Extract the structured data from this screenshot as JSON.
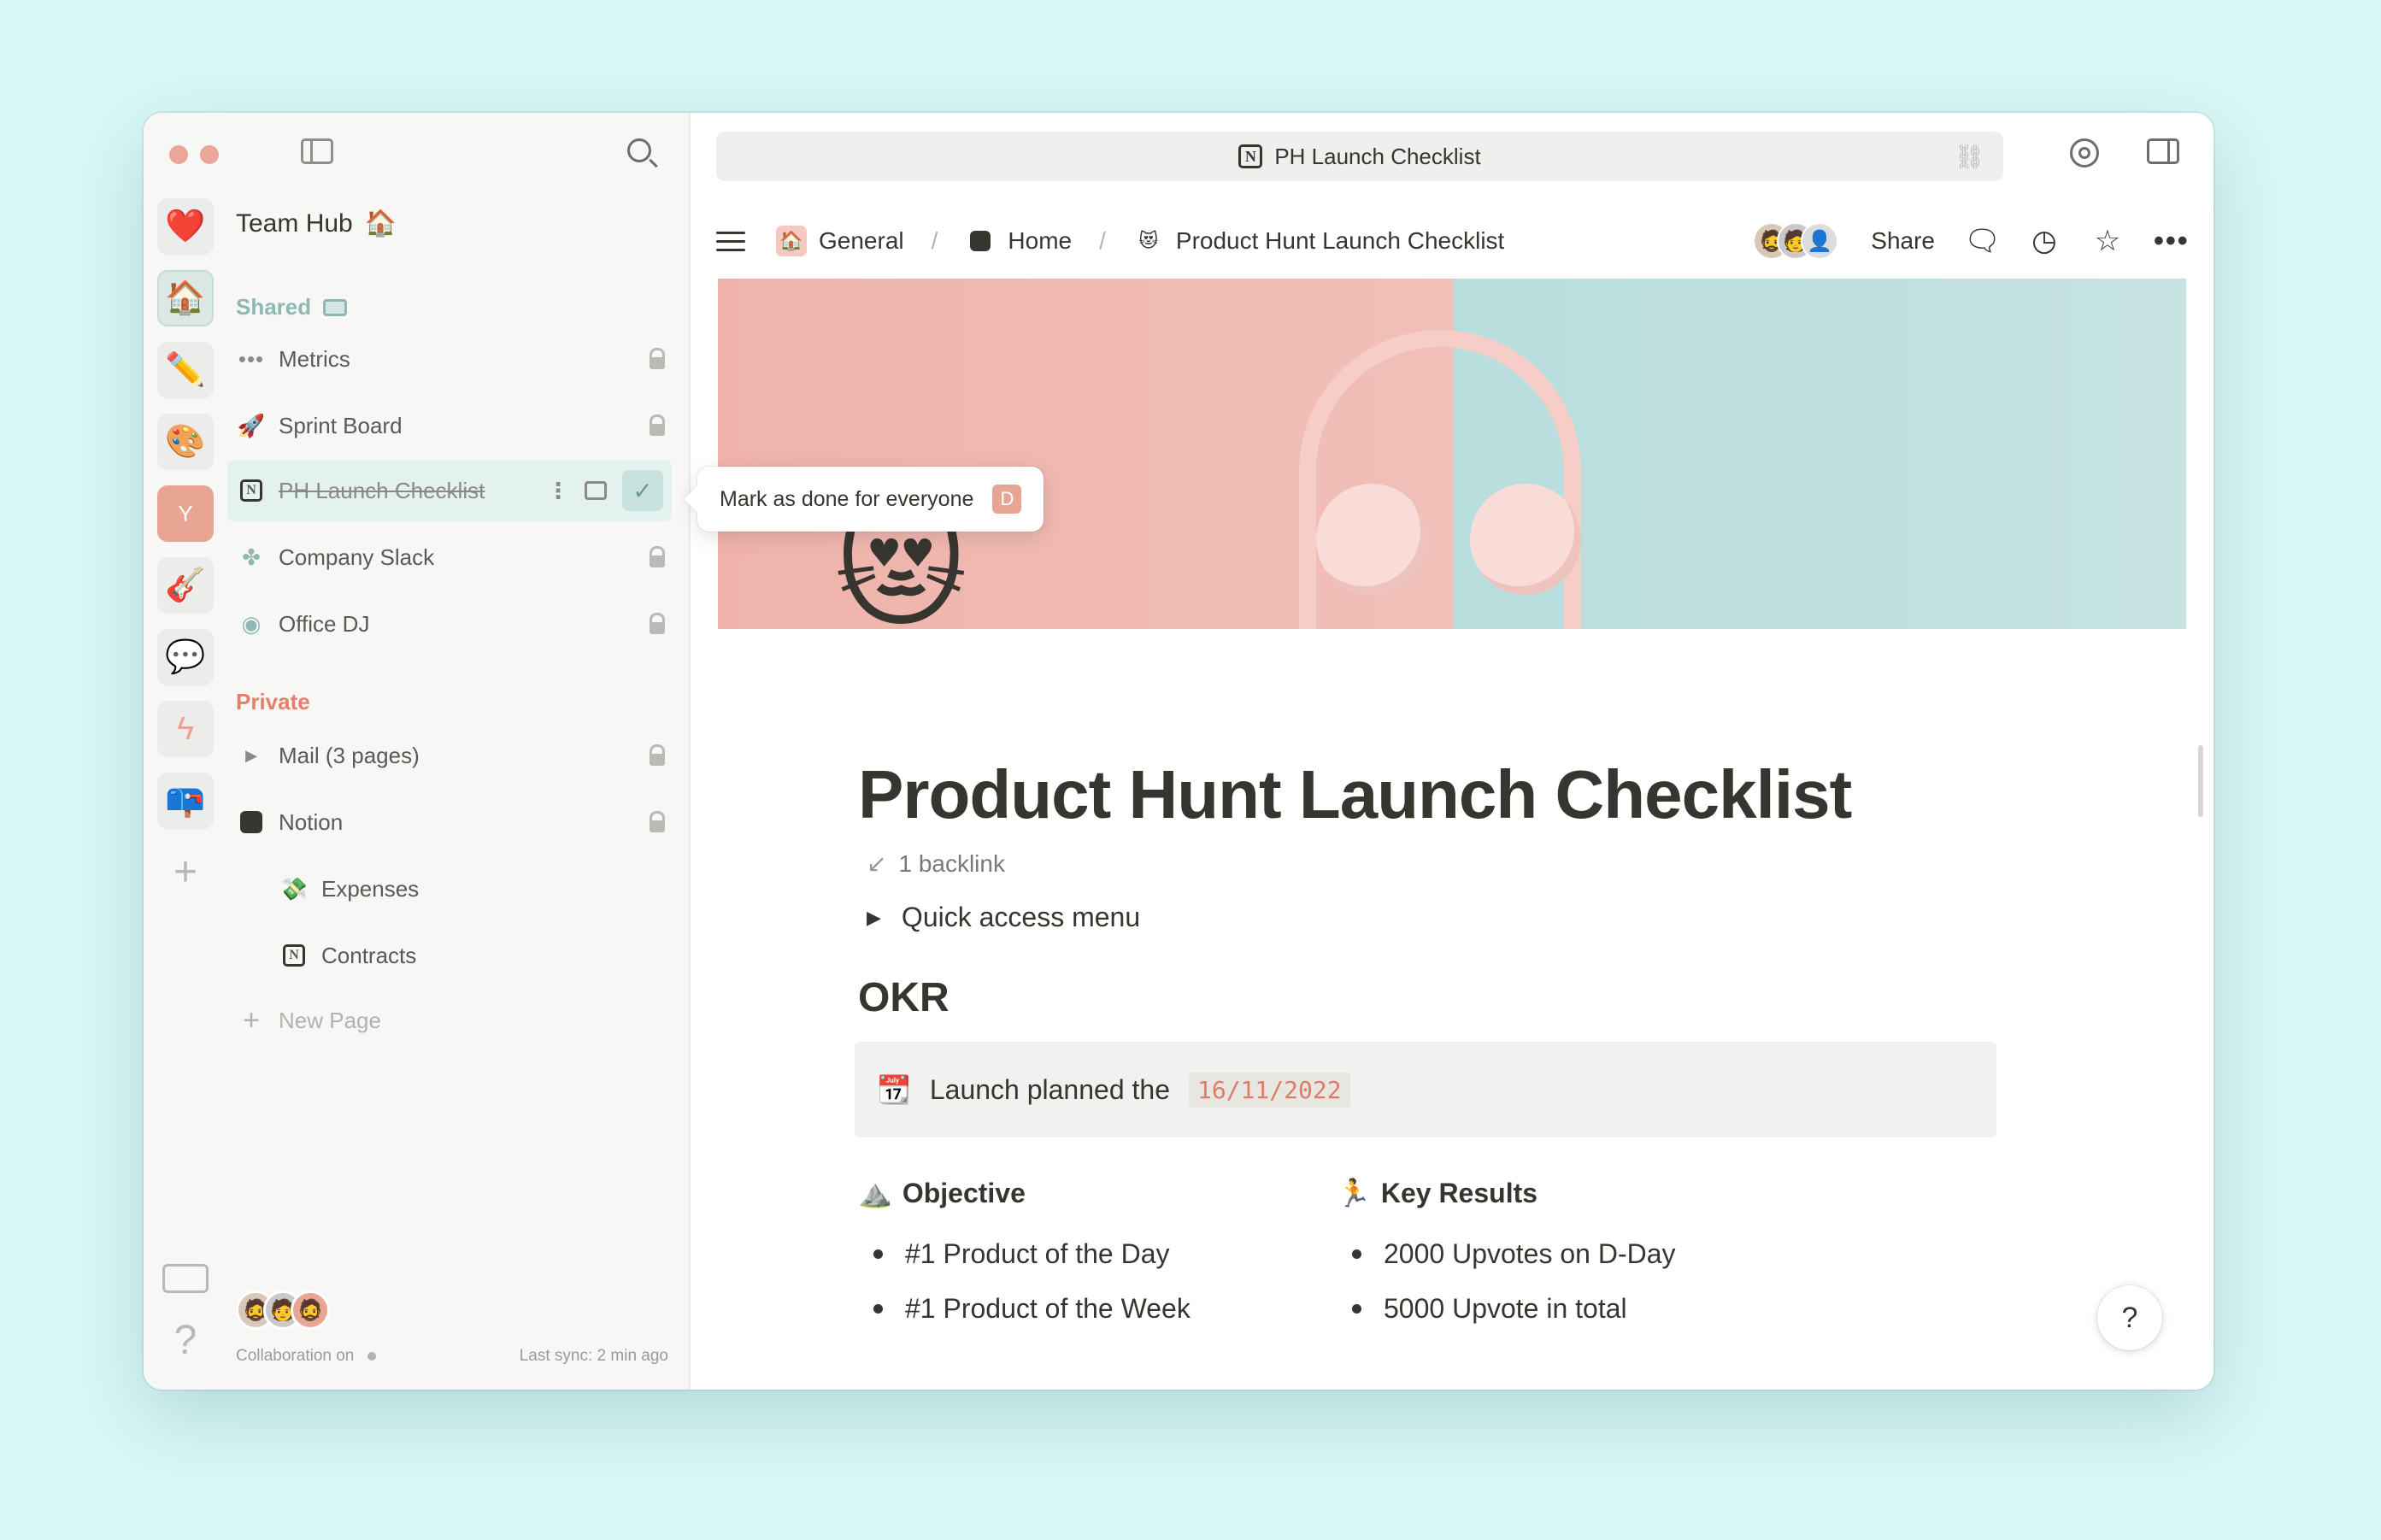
{
  "colors": {
    "background": "#d9f8f8",
    "accent_teal": "#8fb8b3",
    "accent_salmon": "#e57f6a",
    "traffic_red": "#e9a699",
    "traffic_yellow": "#e9a699",
    "traffic_green": "#a9d5d1"
  },
  "rail": {
    "icons": [
      "heart-icon",
      "house-icon",
      "pencil-icon",
      "palette-icon",
      "y-badge-icon",
      "guitar-icon",
      "speech-bubble-icon",
      "lightning-icon",
      "mailbox-icon"
    ],
    "y_badge": "Y",
    "help": "?"
  },
  "sidebar": {
    "workspace_name": "Team Hub",
    "workspace_emoji": "🏠",
    "shared_label": "Shared",
    "private_label": "Private",
    "shared_items": [
      {
        "label": "Metrics",
        "icon": "dots-icon"
      },
      {
        "label": "Sprint Board",
        "icon": "rocket-icon"
      },
      {
        "label": "PH Launch Checklist",
        "icon": "notion-icon"
      },
      {
        "label": "Company Slack",
        "icon": "slack-icon"
      },
      {
        "label": "Office DJ",
        "icon": "spotify-icon"
      }
    ],
    "private_items": [
      {
        "label": "Mail (3 pages)",
        "icon": "chevron-right-icon"
      },
      {
        "label": "Notion",
        "icon": "notion-dark-icon"
      },
      {
        "label": "Expenses",
        "icon": "money-icon"
      },
      {
        "label": "Contracts",
        "icon": "notion-icon"
      }
    ],
    "new_page": "New Page",
    "footer": {
      "collaboration": "Collaboration on",
      "last_sync": "Last sync: 2 min ago"
    }
  },
  "tooltip": {
    "text": "Mark as done for everyone",
    "shortcut": "D"
  },
  "address_bar": {
    "title": "PH Launch Checklist"
  },
  "topbar": {
    "breadcrumbs": [
      {
        "label": "General",
        "icon": "house-icon"
      },
      {
        "label": "Home",
        "icon": "notion-dark-icon"
      },
      {
        "label": "Product Hunt Launch Checklist",
        "icon": "cat-icon"
      }
    ],
    "share": "Share"
  },
  "page": {
    "title": "Product Hunt Launch Checklist",
    "backlink": "1 backlink",
    "toggle": "Quick access menu",
    "okr_heading": "OKR",
    "callout_text": "Launch planned the",
    "callout_date": "16/11/2022",
    "objective": {
      "heading": "Objective",
      "items": [
        "#1 Product of the Day",
        "#1 Product of the Week"
      ]
    },
    "key_results": {
      "heading": "Key Results",
      "items": [
        "2000 Upvotes on D-Day",
        "5000 Upvote in total"
      ]
    }
  },
  "help_button": "?"
}
